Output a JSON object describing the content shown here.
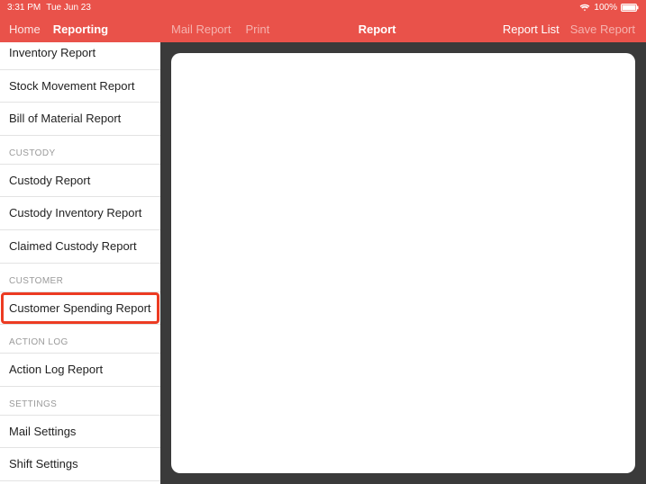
{
  "status": {
    "time": "3:31 PM",
    "date": "Tue Jun 23",
    "battery_pct": "100%"
  },
  "sidebar": {
    "home_label": "Home",
    "title": "Reporting",
    "sections": [
      {
        "header": null,
        "items": [
          {
            "label": "Inventory Report"
          },
          {
            "label": "Stock Movement Report"
          },
          {
            "label": "Bill of Material Report"
          }
        ]
      },
      {
        "header": "CUSTODY",
        "items": [
          {
            "label": "Custody Report"
          },
          {
            "label": "Custody Inventory Report"
          },
          {
            "label": "Claimed Custody Report"
          }
        ]
      },
      {
        "header": "CUSTOMER",
        "items": [
          {
            "label": "Customer Spending Report",
            "highlighted": true
          }
        ]
      },
      {
        "header": "ACTION LOG",
        "items": [
          {
            "label": "Action Log Report"
          }
        ]
      },
      {
        "header": "SETTINGS",
        "items": [
          {
            "label": "Mail Settings"
          },
          {
            "label": "Shift Settings"
          }
        ]
      }
    ]
  },
  "main": {
    "mail_report": "Mail Report",
    "print": "Print",
    "title": "Report",
    "report_list": "Report List",
    "save_report": "Save Report"
  }
}
